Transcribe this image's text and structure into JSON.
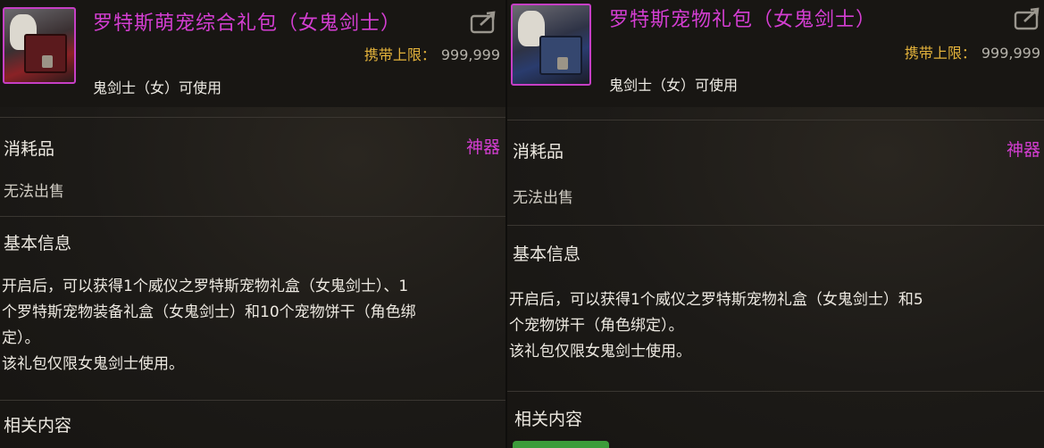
{
  "left": {
    "title": "罗特斯萌宠综合礼包（女鬼剑士）",
    "carry_limit_label": "携带上限：",
    "carry_limit_value": "999,999",
    "usable_by": "鬼剑士（女）可使用",
    "category": "消耗品",
    "grade": "神器",
    "sell_status": "无法出售",
    "section_title": "基本信息",
    "description": [
      "开启后，可以获得1个威仪之罗特斯宠物礼盒（女鬼剑士）、1",
      "个罗特斯宠物装备礼盒（女鬼剑士）和10个宠物饼干（角色绑",
      "定）。",
      "该礼包仅限女鬼剑士使用。"
    ],
    "related_title": "相关内容"
  },
  "right": {
    "title": "罗特斯宠物礼包（女鬼剑士）",
    "carry_limit_label": "携带上限：",
    "carry_limit_value": "999,999",
    "usable_by": "鬼剑士（女）可使用",
    "category": "消耗品",
    "grade": "神器",
    "sell_status": "无法出售",
    "section_title": "基本信息",
    "description": [
      "开启后，可以获得1个威仪之罗特斯宠物礼盒（女鬼剑士）和5",
      "个宠物饼干（角色绑定）。",
      "该礼包仅限女鬼剑士使用。"
    ],
    "related_title": "相关内容"
  },
  "colors": {
    "grade": "#d43ed2",
    "limit_label": "#e3b23b",
    "button_green": "#3c9c3a"
  },
  "icons": {
    "share": "share-icon",
    "item": "gift-box-icon"
  }
}
